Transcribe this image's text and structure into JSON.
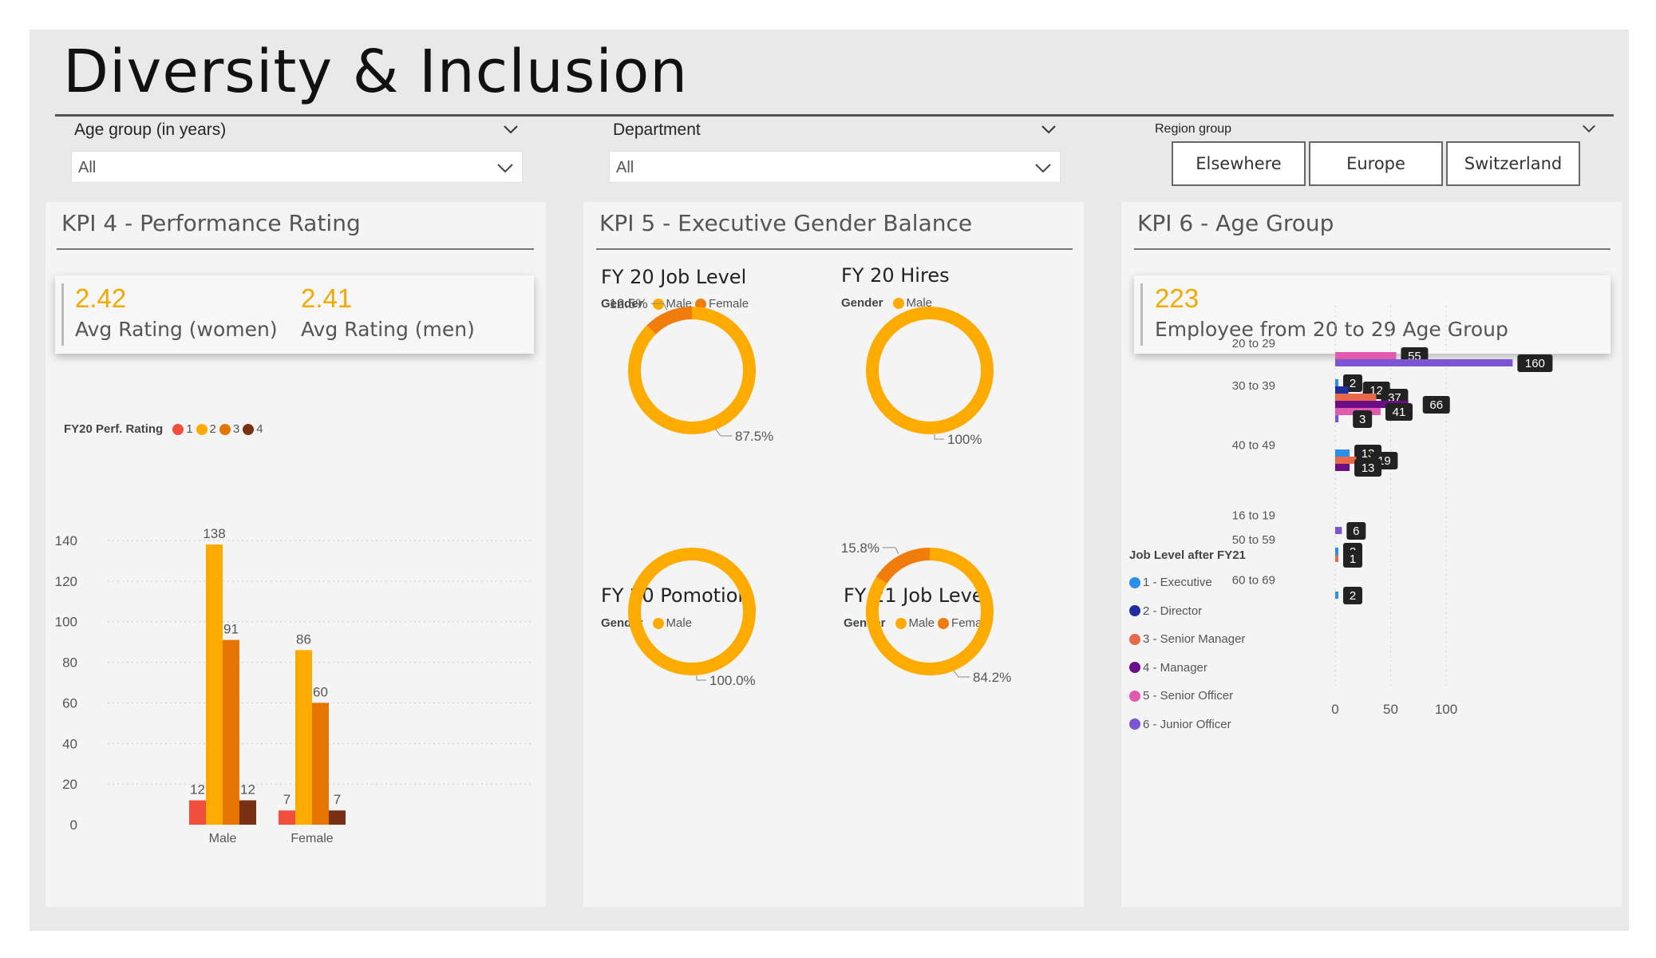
{
  "title": "Diversity & Inclusion",
  "slicers": {
    "age": {
      "label": "Age group (in years)",
      "value": "All"
    },
    "department": {
      "label": "Department",
      "value": "All"
    },
    "region": {
      "label": "Region group",
      "options": [
        "Elsewhere",
        "Europe",
        "Switzerland"
      ]
    }
  },
  "kpi4": {
    "title": "KPI 4 - Performance Rating",
    "women_value": "2.42",
    "women_label": "Avg Rating (women)",
    "men_value": "2.41",
    "men_label": "Avg Rating (men)"
  },
  "kpi5": {
    "title": "KPI 5 - Executive Gender Balance",
    "gender_label": "Gender",
    "male_label": "Male",
    "female_label": "Female"
  },
  "kpi6": {
    "title": "KPI 6 - Age Group",
    "value": "223",
    "label": "Employee from 20 to 29 Age Group"
  },
  "colors": {
    "accent": "#f2a900",
    "male": "#fdab00",
    "female": "#f07d0b",
    "rating_1": "#f24e3e",
    "rating_2": "#fdab00",
    "rating_3": "#e67500",
    "rating_4": "#7a3012"
  },
  "chart_data": [
    {
      "type": "bar",
      "legend_title": "FY20 Perf. Rating",
      "categories": [
        "Male",
        "Female"
      ],
      "series": [
        {
          "name": "1",
          "color": "#f24e3e",
          "values": [
            12,
            7
          ]
        },
        {
          "name": "2",
          "color": "#fdab00",
          "values": [
            138,
            86
          ]
        },
        {
          "name": "3",
          "color": "#e67500",
          "values": [
            91,
            60
          ]
        },
        {
          "name": "4",
          "color": "#7a3012",
          "values": [
            12,
            7
          ]
        }
      ],
      "ylim": [
        0,
        140
      ],
      "yticks": [
        0,
        20,
        40,
        60,
        80,
        100,
        120,
        140
      ],
      "grid": true,
      "legend_position": "top-left"
    },
    {
      "type": "pie",
      "title": "FY 20 Job Level",
      "legend": [
        "Male",
        "Female"
      ],
      "slices": [
        {
          "name": "Male",
          "value": 87.5,
          "label": "87.5%",
          "color": "#fdab00"
        },
        {
          "name": "Female",
          "value": 12.5,
          "label": "12.5%",
          "color": "#f07d0b"
        }
      ]
    },
    {
      "type": "pie",
      "title": "FY 20 Hires",
      "legend": [
        "Male"
      ],
      "slices": [
        {
          "name": "Male",
          "value": 100,
          "label": "100%",
          "color": "#fdab00"
        }
      ]
    },
    {
      "type": "pie",
      "title": "FY 20 Pomotion",
      "legend": [
        "Male"
      ],
      "slices": [
        {
          "name": "Male",
          "value": 100,
          "label": "100.0%",
          "color": "#fdab00"
        }
      ]
    },
    {
      "type": "pie",
      "title": "FY 21 Job Level",
      "legend": [
        "Male",
        "Female"
      ],
      "slices": [
        {
          "name": "Male",
          "value": 84.2,
          "label": "84.2%",
          "color": "#fdab00"
        },
        {
          "name": "Female",
          "value": 15.8,
          "label": "15.8%",
          "color": "#f07d0b"
        }
      ]
    },
    {
      "type": "bar",
      "orientation": "horizontal",
      "legend_title": "Job Level after FY21",
      "legend": [
        {
          "name": "1 - Executive",
          "color": "#2b8ee8"
        },
        {
          "name": "2 - Director",
          "color": "#1f2f9e"
        },
        {
          "name": "3 - Senior Manager",
          "color": "#e8684a"
        },
        {
          "name": "4 - Manager",
          "color": "#6b0e87"
        },
        {
          "name": "5 - Senior Officer",
          "color": "#e25ab0"
        },
        {
          "name": "6 - Junior Officer",
          "color": "#7b55d3"
        }
      ],
      "categories": [
        {
          "name": "20 to 29",
          "bars": [
            {
              "level": 5,
              "value": 55
            },
            {
              "level": 6,
              "value": 160
            }
          ]
        },
        {
          "name": "30 to 39",
          "bars": [
            {
              "level": 1,
              "value": 2
            },
            {
              "level": 2,
              "value": 12
            },
            {
              "level": 3,
              "value": 37
            },
            {
              "level": 4,
              "value": 66
            },
            {
              "level": 5,
              "value": 41
            },
            {
              "level": 6,
              "value": 3
            }
          ]
        },
        {
          "name": "40 to 49",
          "bars": [
            {
              "level": 1,
              "value": 13
            },
            {
              "level": 3,
              "value": 19
            },
            {
              "level": 4,
              "value": 13
            }
          ]
        },
        {
          "name": "16 to 19",
          "bars": [
            {
              "level": 6,
              "value": 6
            }
          ]
        },
        {
          "name": "50 to 59",
          "bars": [
            {
              "level": 1,
              "value": 2
            },
            {
              "level": 3,
              "value": 1
            }
          ]
        },
        {
          "name": "60 to 69",
          "bars": [
            {
              "level": 1,
              "value": 2
            }
          ]
        }
      ],
      "xlim": [
        0,
        100
      ],
      "xticks": [
        0,
        50,
        100
      ],
      "grid": true,
      "legend_position": "left"
    }
  ]
}
